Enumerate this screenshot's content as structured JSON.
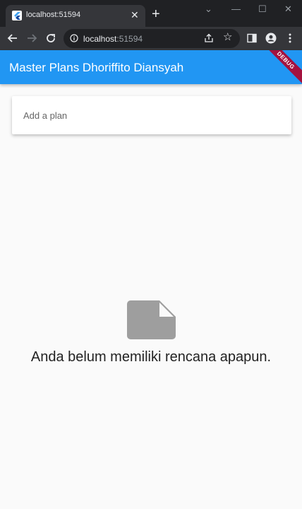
{
  "browser": {
    "tab": {
      "title": "localhost:51594"
    },
    "address": {
      "host": "localhost",
      "port": ":51594"
    }
  },
  "app": {
    "title": "Master Plans Dhoriffito Diansyah",
    "debug_banner": "DEBUG",
    "input": {
      "placeholder": "Add a plan"
    },
    "empty_state": {
      "icon": "note-icon",
      "message": "Anda belum memiliki rencana apapun."
    }
  },
  "colors": {
    "appbar": "#2196f3",
    "icon": "#9e9e9e",
    "background": "#fafafa"
  }
}
